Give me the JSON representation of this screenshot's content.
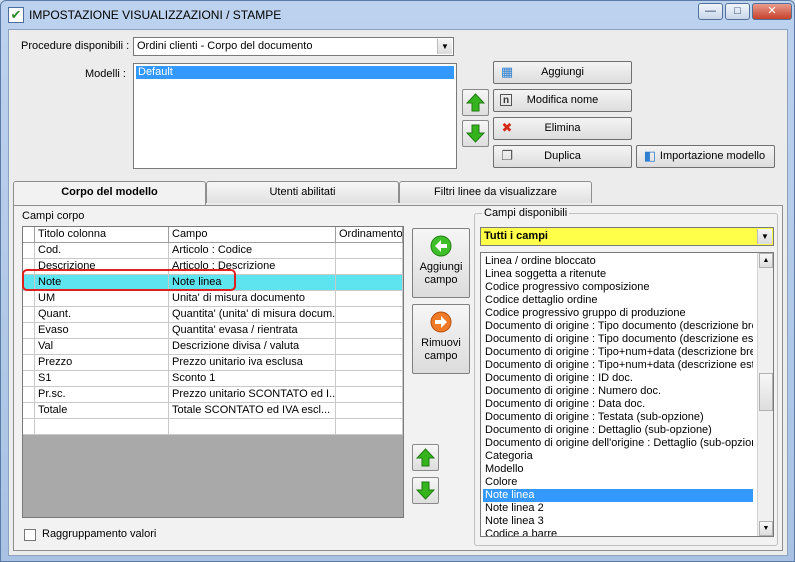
{
  "window": {
    "title": "IMPOSTAZIONE VISUALIZZAZIONI / STAMPE",
    "min_label": "—",
    "max_label": "□",
    "close_label": "✕"
  },
  "top": {
    "procedure_label": "Procedure disponibili :",
    "procedure_value": "Ordini clienti - Corpo del documento",
    "modelli_label": "Modelli :",
    "modelli_items": [
      "Default"
    ],
    "buttons": {
      "aggiungi": "Aggiungi",
      "modifica_nome": "Modifica nome",
      "elimina": "Elimina",
      "duplica": "Duplica",
      "importazione": "Importazione modello"
    }
  },
  "tabs": [
    {
      "label": "Corpo del modello"
    },
    {
      "label": "Utenti abilitati"
    },
    {
      "label": "Filtri linee da visualizzare"
    }
  ],
  "corpo": {
    "group_label": "Campi corpo",
    "columns": [
      "Titolo colonna",
      "Campo",
      "Ordinamento"
    ],
    "rows": [
      {
        "titolo": "Cod.",
        "campo": "Articolo : Codice",
        "ord": ""
      },
      {
        "titolo": "Descrizione",
        "campo": "Articolo : Descrizione",
        "ord": ""
      },
      {
        "titolo": "Note",
        "campo": "Note linea",
        "ord": ""
      },
      {
        "titolo": "UM",
        "campo": "Unita' di misura documento",
        "ord": ""
      },
      {
        "titolo": "Quant.",
        "campo": "Quantita' (unita' di misura docum...",
        "ord": ""
      },
      {
        "titolo": "Evaso",
        "campo": "Quantita' evasa / rientrata",
        "ord": ""
      },
      {
        "titolo": "Val",
        "campo": "Descrizione divisa / valuta",
        "ord": ""
      },
      {
        "titolo": "Prezzo",
        "campo": "Prezzo unitario iva esclusa",
        "ord": ""
      },
      {
        "titolo": "S1",
        "campo": "Sconto 1",
        "ord": ""
      },
      {
        "titolo": "Pr.sc.",
        "campo": "Prezzo unitario SCONTATO ed I...",
        "ord": ""
      },
      {
        "titolo": "Totale",
        "campo": "Totale SCONTATO ed IVA escl...",
        "ord": ""
      },
      {
        "titolo": "",
        "campo": "",
        "ord": ""
      }
    ],
    "aggiungi_campo": "Aggiungi campo",
    "rimuovi_campo": "Rimuovi campo",
    "raggruppamento": "Raggruppamento valori"
  },
  "disponibili": {
    "group_label": "Campi disponibili",
    "filter_value": "Tutti i campi",
    "items": [
      "Linea / ordine bloccato",
      "Linea soggetta a ritenute",
      "Codice progressivo composizione",
      "Codice dettaglio ordine",
      "Codice progressivo gruppo di produzione",
      "Documento di origine : Tipo documento (descrizione breve)",
      "Documento di origine : Tipo documento (descrizione estesa)",
      "Documento di origine : Tipo+num+data (descrizione breve)",
      "Documento di origine : Tipo+num+data (descrizione estesa)",
      "Documento di origine : ID doc.",
      "Documento di origine : Numero doc.",
      "Documento di origine : Data doc.",
      "Documento di origine : Testata (sub-opzione)",
      "Documento di origine : Dettaglio (sub-opzione)",
      "Documento di origine dell'origine : Dettaglio (sub-opzione)",
      "Categoria",
      "Modello",
      "Colore",
      "Note linea",
      "Note linea 2",
      "Note linea 3",
      "Codice a barre"
    ],
    "selected_index": 18
  },
  "colors": {
    "selected_row": "#5ee4ee",
    "filter_bg": "#ffff4a",
    "list_selection": "#3399ff",
    "highlight_border": "#e0201a"
  }
}
